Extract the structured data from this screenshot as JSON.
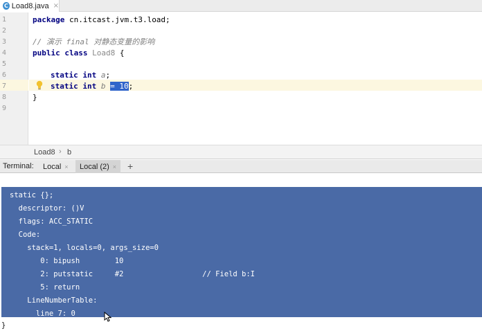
{
  "editor_tab": {
    "icon_letter": "C",
    "label": "Load8.java",
    "close": "×"
  },
  "gutter": {
    "line_numbers": [
      "1",
      "2",
      "3",
      "4",
      "5",
      "6",
      "7",
      "8",
      "9"
    ]
  },
  "code": {
    "l1_kw": "package",
    "l1_rest": " cn.itcast.jvm.t3.load;",
    "l3_comment": "// 演示 final 对静态变量的影响",
    "l4_kw": "public class",
    "l4_name": "Load8",
    "l4_rest": " {",
    "l6_kw": "static int",
    "l6_field": "a",
    "l6_rest": ";",
    "l7_kw": "static int",
    "l7_field": "b",
    "l7_selected": "= 10",
    "l7_rest": ";",
    "l8": "}"
  },
  "breadcrumb": {
    "class": "Load8",
    "sep": "›",
    "member": "b"
  },
  "terminal_bar": {
    "title": "Terminal:",
    "tabs": [
      {
        "label": "Local",
        "close": "×"
      },
      {
        "label": "Local (2)",
        "close": "×"
      }
    ],
    "add": "+"
  },
  "terminal_lines": [
    "static {};",
    "  descriptor: ()V",
    "  flags: ACC_STATIC",
    "  Code:",
    "    stack=1, locals=0, args_size=0",
    "       0: bipush        10",
    "       2: putstatic     #2                  // Field b:I",
    "       5: return",
    "    LineNumberTable:",
    "      line 7: 0",
    "}"
  ],
  "colors": {
    "selection": "#4a6aa6",
    "current_line": "#fcf7e0",
    "keyword": "#000080"
  }
}
